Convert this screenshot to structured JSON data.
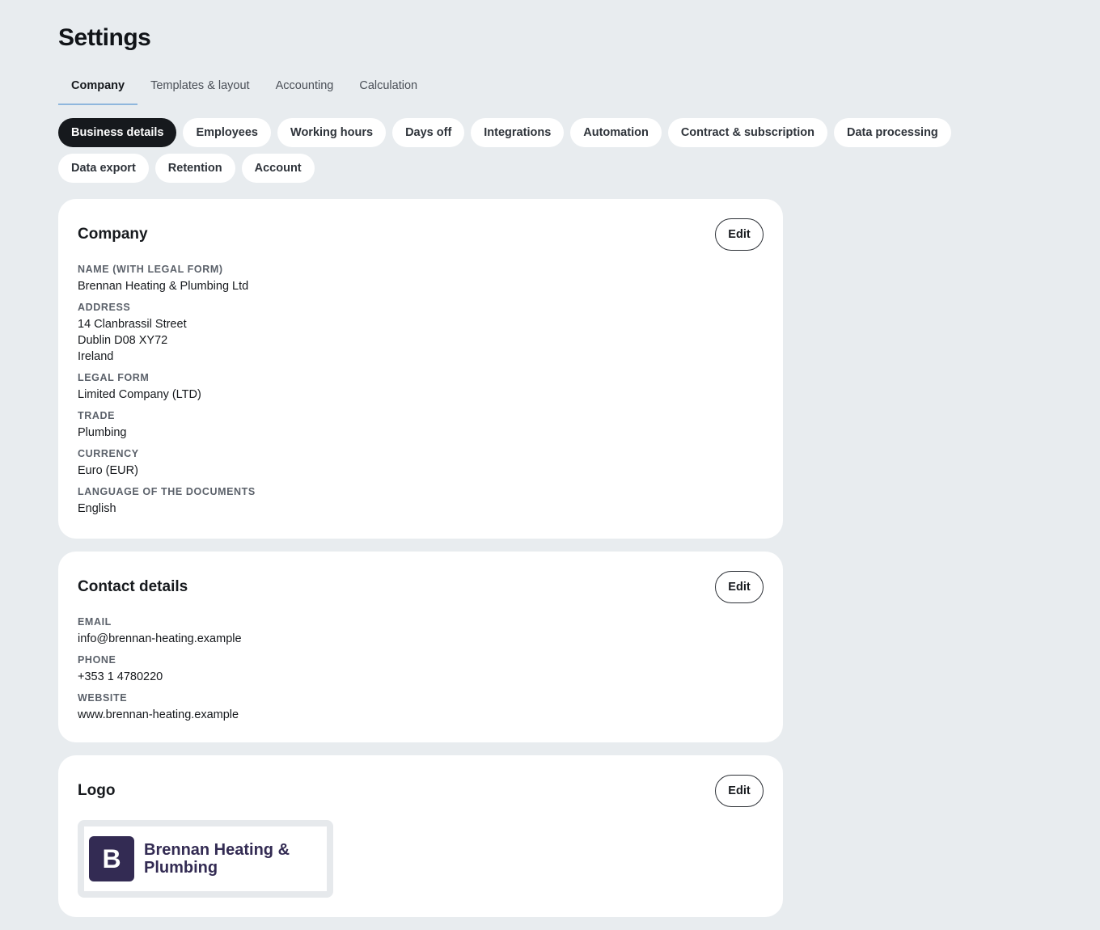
{
  "page": {
    "title": "Settings"
  },
  "tabs": [
    {
      "label": "Company",
      "active": true
    },
    {
      "label": "Templates & layout",
      "active": false
    },
    {
      "label": "Accounting",
      "active": false
    },
    {
      "label": "Calculation",
      "active": false
    }
  ],
  "subnav": [
    {
      "label": "Business details",
      "active": true
    },
    {
      "label": "Employees",
      "active": false
    },
    {
      "label": "Working hours",
      "active": false
    },
    {
      "label": "Days off",
      "active": false
    },
    {
      "label": "Integrations",
      "active": false
    },
    {
      "label": "Automation",
      "active": false
    },
    {
      "label": "Contract & subscription",
      "active": false
    },
    {
      "label": "Data processing",
      "active": false
    },
    {
      "label": "Data export",
      "active": false
    },
    {
      "label": "Retention",
      "active": false
    },
    {
      "label": "Account",
      "active": false
    }
  ],
  "company_card": {
    "title": "Company",
    "edit_label": "Edit",
    "fields": {
      "name": {
        "label": "Name (with legal form)",
        "value": "Brennan Heating & Plumbing Ltd"
      },
      "address": {
        "label": "Address",
        "line1": "14 Clanbrassil Street",
        "line2": "Dublin D08 XY72",
        "line3": "Ireland"
      },
      "legal_form": {
        "label": "Legal form",
        "value": "Limited Company (LTD)"
      },
      "trade": {
        "label": "Trade",
        "value": "Plumbing"
      },
      "currency": {
        "label": "Currency",
        "value": "Euro (EUR)"
      },
      "language": {
        "label": "Language of the documents",
        "value": "English"
      }
    }
  },
  "contact_card": {
    "title": "Contact details",
    "edit_label": "Edit",
    "fields": {
      "email": {
        "label": "Email",
        "value": "info@brennan-heating.example"
      },
      "phone": {
        "label": "Phone",
        "value": "+353 1 4780220"
      },
      "website": {
        "label": "Website",
        "value": "www.brennan-heating.example"
      }
    }
  },
  "logo_card": {
    "title": "Logo",
    "edit_label": "Edit",
    "logo": {
      "mark": "B",
      "text": "Brennan Heating & Plumbing"
    }
  }
}
